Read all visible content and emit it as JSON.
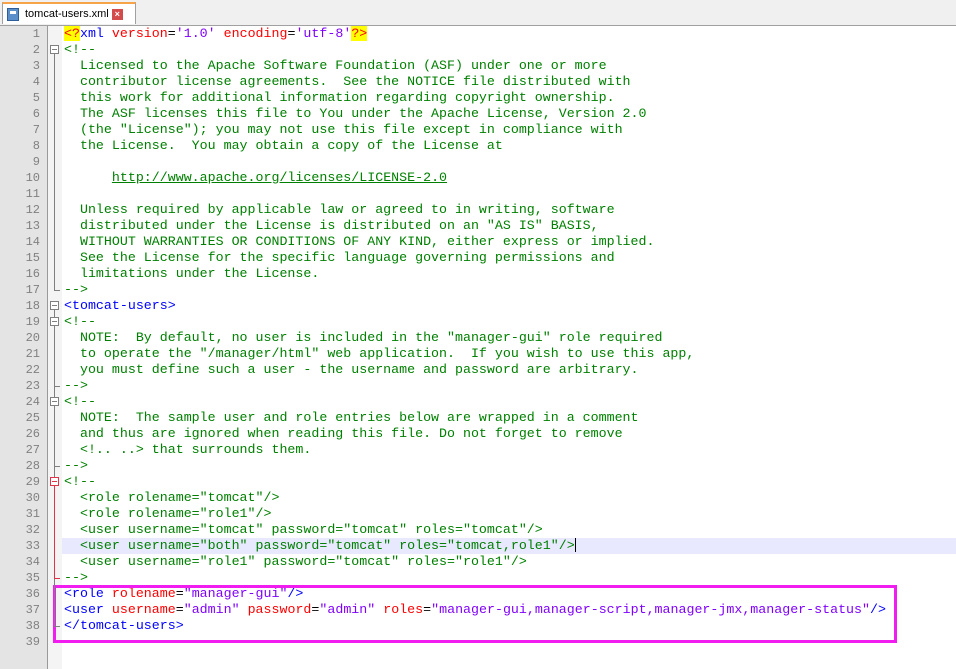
{
  "tab": {
    "title": "tomcat-users.xml",
    "icon": "file-icon",
    "close_icon": "close-icon"
  },
  "colors": {
    "comment": "#008000",
    "tag": "#0000ff",
    "attribute": "#ff0000",
    "value": "#8000ff",
    "highlight_box": "#f01cf0",
    "current_line": "#e8e8ff"
  },
  "current_line": 33,
  "lines": [
    {
      "n": "1",
      "tokens": [
        {
          "c": "pi",
          "t": "<?"
        },
        {
          "c": "tg",
          "t": "xml "
        },
        {
          "c": "at",
          "t": "version"
        },
        {
          "c": "tx",
          "t": "="
        },
        {
          "c": "vl",
          "t": "'1.0'"
        },
        {
          "c": "tx",
          "t": " "
        },
        {
          "c": "at",
          "t": "encoding"
        },
        {
          "c": "tx",
          "t": "="
        },
        {
          "c": "vl",
          "t": "'utf-8'"
        },
        {
          "c": "pi",
          "t": "?>"
        }
      ]
    },
    {
      "n": "2",
      "tokens": [
        {
          "c": "cm",
          "t": "<!--"
        }
      ]
    },
    {
      "n": "3",
      "tokens": [
        {
          "c": "cm",
          "t": "  Licensed to the Apache Software Foundation (ASF) under one or more"
        }
      ]
    },
    {
      "n": "4",
      "tokens": [
        {
          "c": "cm",
          "t": "  contributor license agreements.  See the NOTICE file distributed with"
        }
      ]
    },
    {
      "n": "5",
      "tokens": [
        {
          "c": "cm",
          "t": "  this work for additional information regarding copyright ownership."
        }
      ]
    },
    {
      "n": "6",
      "tokens": [
        {
          "c": "cm",
          "t": "  The ASF licenses this file to You under the Apache License, Version 2.0"
        }
      ]
    },
    {
      "n": "7",
      "tokens": [
        {
          "c": "cm",
          "t": "  (the \"License\"); you may not use this file except in compliance with"
        }
      ]
    },
    {
      "n": "8",
      "tokens": [
        {
          "c": "cm",
          "t": "  the License.  You may obtain a copy of the License at"
        }
      ]
    },
    {
      "n": "9",
      "tokens": []
    },
    {
      "n": "10",
      "tokens": [
        {
          "c": "cm",
          "t": "      "
        },
        {
          "c": "url",
          "t": "http://www.apache.org/licenses/LICENSE-2.0"
        }
      ]
    },
    {
      "n": "11",
      "tokens": []
    },
    {
      "n": "12",
      "tokens": [
        {
          "c": "cm",
          "t": "  Unless required by applicable law or agreed to in writing, software"
        }
      ]
    },
    {
      "n": "13",
      "tokens": [
        {
          "c": "cm",
          "t": "  distributed under the License is distributed on an \"AS IS\" BASIS,"
        }
      ]
    },
    {
      "n": "14",
      "tokens": [
        {
          "c": "cm",
          "t": "  WITHOUT WARRANTIES OR CONDITIONS OF ANY KIND, either express or implied."
        }
      ]
    },
    {
      "n": "15",
      "tokens": [
        {
          "c": "cm",
          "t": "  See the License for the specific language governing permissions and"
        }
      ]
    },
    {
      "n": "16",
      "tokens": [
        {
          "c": "cm",
          "t": "  limitations under the License."
        }
      ]
    },
    {
      "n": "17",
      "tokens": [
        {
          "c": "cm",
          "t": "-->"
        }
      ]
    },
    {
      "n": "18",
      "tokens": [
        {
          "c": "tg",
          "t": "<tomcat-users>"
        }
      ]
    },
    {
      "n": "19",
      "tokens": [
        {
          "c": "cm",
          "t": "<!--"
        }
      ]
    },
    {
      "n": "20",
      "tokens": [
        {
          "c": "cm",
          "t": "  NOTE:  By default, no user is included in the \"manager-gui\" role required"
        }
      ]
    },
    {
      "n": "21",
      "tokens": [
        {
          "c": "cm",
          "t": "  to operate the \"/manager/html\" web application.  If you wish to use this app,"
        }
      ]
    },
    {
      "n": "22",
      "tokens": [
        {
          "c": "cm",
          "t": "  you must define such a user - the username and password are arbitrary."
        }
      ]
    },
    {
      "n": "23",
      "tokens": [
        {
          "c": "cm",
          "t": "-->"
        }
      ]
    },
    {
      "n": "24",
      "tokens": [
        {
          "c": "cm",
          "t": "<!--"
        }
      ]
    },
    {
      "n": "25",
      "tokens": [
        {
          "c": "cm",
          "t": "  NOTE:  The sample user and role entries below are wrapped in a comment"
        }
      ]
    },
    {
      "n": "26",
      "tokens": [
        {
          "c": "cm",
          "t": "  and thus are ignored when reading this file. Do not forget to remove"
        }
      ]
    },
    {
      "n": "27",
      "tokens": [
        {
          "c": "cm",
          "t": "  <!.. ..> that surrounds them."
        }
      ]
    },
    {
      "n": "28",
      "tokens": [
        {
          "c": "cm",
          "t": "-->"
        }
      ]
    },
    {
      "n": "29",
      "tokens": [
        {
          "c": "cm",
          "t": "<!--"
        }
      ]
    },
    {
      "n": "30",
      "tokens": [
        {
          "c": "cm",
          "t": "  <role rolename=\"tomcat\"/>"
        }
      ]
    },
    {
      "n": "31",
      "tokens": [
        {
          "c": "cm",
          "t": "  <role rolename=\"role1\"/>"
        }
      ]
    },
    {
      "n": "32",
      "tokens": [
        {
          "c": "cm",
          "t": "  <user username=\"tomcat\" password=\"tomcat\" roles=\"tomcat\"/>"
        }
      ]
    },
    {
      "n": "33",
      "tokens": [
        {
          "c": "cm",
          "t": "  <user username=\"both\" password=\"tomcat\" roles=\"tomcat,role1\"/>"
        }
      ]
    },
    {
      "n": "34",
      "tokens": [
        {
          "c": "cm",
          "t": "  <user username=\"role1\" password=\"tomcat\" roles=\"role1\"/>"
        }
      ]
    },
    {
      "n": "35",
      "tokens": [
        {
          "c": "cm",
          "t": "-->"
        }
      ]
    },
    {
      "n": "36",
      "tokens": [
        {
          "c": "tg",
          "t": "<role "
        },
        {
          "c": "at",
          "t": "rolename"
        },
        {
          "c": "tx",
          "t": "="
        },
        {
          "c": "vl",
          "t": "\"manager-gui\""
        },
        {
          "c": "tg",
          "t": "/>"
        }
      ]
    },
    {
      "n": "37",
      "tokens": [
        {
          "c": "tg",
          "t": "<user "
        },
        {
          "c": "at",
          "t": "username"
        },
        {
          "c": "tx",
          "t": "="
        },
        {
          "c": "vl",
          "t": "\"admin\""
        },
        {
          "c": "tx",
          "t": " "
        },
        {
          "c": "at",
          "t": "password"
        },
        {
          "c": "tx",
          "t": "="
        },
        {
          "c": "vl",
          "t": "\"admin\""
        },
        {
          "c": "tx",
          "t": " "
        },
        {
          "c": "at",
          "t": "roles"
        },
        {
          "c": "tx",
          "t": "="
        },
        {
          "c": "vl",
          "t": "\"manager-gui,manager-script,manager-jmx,manager-status\""
        },
        {
          "c": "tg",
          "t": "/>"
        }
      ]
    },
    {
      "n": "38",
      "tokens": [
        {
          "c": "tg",
          "t": "</tomcat-users>"
        }
      ]
    },
    {
      "n": "39",
      "tokens": []
    }
  ]
}
